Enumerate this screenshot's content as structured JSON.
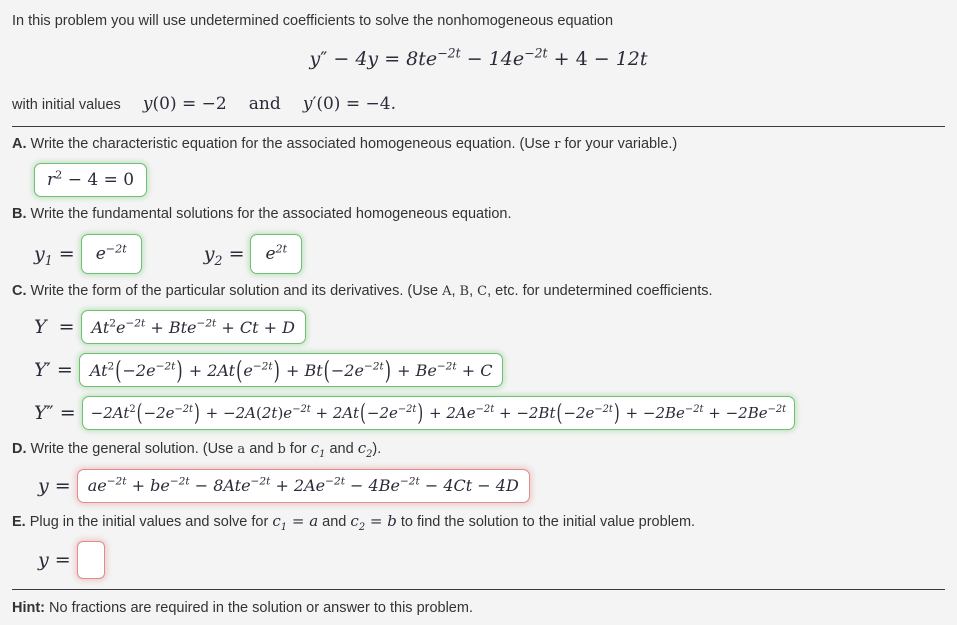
{
  "problem": {
    "intro": "In this problem you will use undetermined coefficients to solve the nonhomogeneous equation",
    "initial_values_label": "with initial values",
    "and_word": "and"
  },
  "equation": {
    "lhs": "y″ − 4y =",
    "rhs_term1": "8te",
    "rhs_exp1": "−2t",
    "rhs_term2": "− 14e",
    "rhs_exp2": "−2t",
    "rhs_tail": "+ 4 − 12t",
    "plain": "y'' − 4y = 8te^(−2t) − 14e^(−2t) + 4 − 12t"
  },
  "initial": {
    "y0": "y(0) = −2",
    "yp0": "y′(0) = −4."
  },
  "parts": {
    "a": {
      "label": "A.",
      "text": "Write the characteristic equation for the associated homogeneous equation. (Use",
      "variable": "r",
      "text_tail": "for your variable.)",
      "answer": "r² − 4 = 0",
      "status": "correct"
    },
    "b": {
      "label": "B.",
      "text": "Write the fundamental solutions for the associated homogeneous equation.",
      "y1_label": "y₁ =",
      "y1_answer": "e^(−2t)",
      "y1_status": "correct",
      "y2_label": "y₂ =",
      "y2_answer": "e^(2t)",
      "y2_status": "correct"
    },
    "c": {
      "label": "C.",
      "text": "Write the form of the particular solution and its derivatives. (Use",
      "coeff_a": "A",
      "coeff_b": "B",
      "coeff_c": "C",
      "text_tail": "etc. for undetermined coefficients.",
      "Y_label": "Y  =",
      "Y_answer": "At²e^(−2t) + Bte^(−2t) + Ct + D",
      "Y_status": "correct",
      "Yp_label": "Y′ =",
      "Yp_answer": "At²(−2e^(−2t)) + 2At(e^(−2t)) + Bt(−2e^(−2t)) + Be^(−2t) + C",
      "Yp_status": "correct",
      "Ypp_label": "Y″ =",
      "Ypp_answer": "−2At²(−2e^(−2t)) + −2A(2t)e^(−2t) + 2At(−2e^(−2t)) + 2Ae^(−2t) + −2Bt(−2e^(−2t)) + −2Be^(−2t) + −2Be^(−2t)",
      "Ypp_status": "correct"
    },
    "d": {
      "label": "D.",
      "text": "Write the general solution. (Use",
      "var_a": "a",
      "and_word": "and",
      "var_b": "b",
      "text_mid": "for",
      "c1": "c₁",
      "c2": "c₂",
      "text_tail": ").",
      "y_label": "y =",
      "answer": "ae^(−2t) + be^(−2t) − 8Ate^(−2t) + 2Ae^(−2t) − 4Be^(−2t) − 4Ct − 4D",
      "status": "incorrect"
    },
    "e": {
      "label": "E.",
      "text_1": "Plug in the initial values and solve for",
      "c1_eq": "c₁ = a",
      "and_word": "and",
      "c2_eq": "c₂ = b",
      "text_2": "to find the solution to the initial value problem.",
      "y_label": "y =",
      "answer": "",
      "status": "incorrect"
    }
  },
  "hint": {
    "label": "Hint:",
    "text": "No fractions are required in the solution or answer to this problem."
  },
  "colors": {
    "background": "#f4f4f4",
    "text": "#333333",
    "math": "#2b2b3a",
    "correct_border": "#6fbf73",
    "incorrect_border": "#e08b8b",
    "rule": "#3a3a3a",
    "box_fill": "#ffffff"
  }
}
